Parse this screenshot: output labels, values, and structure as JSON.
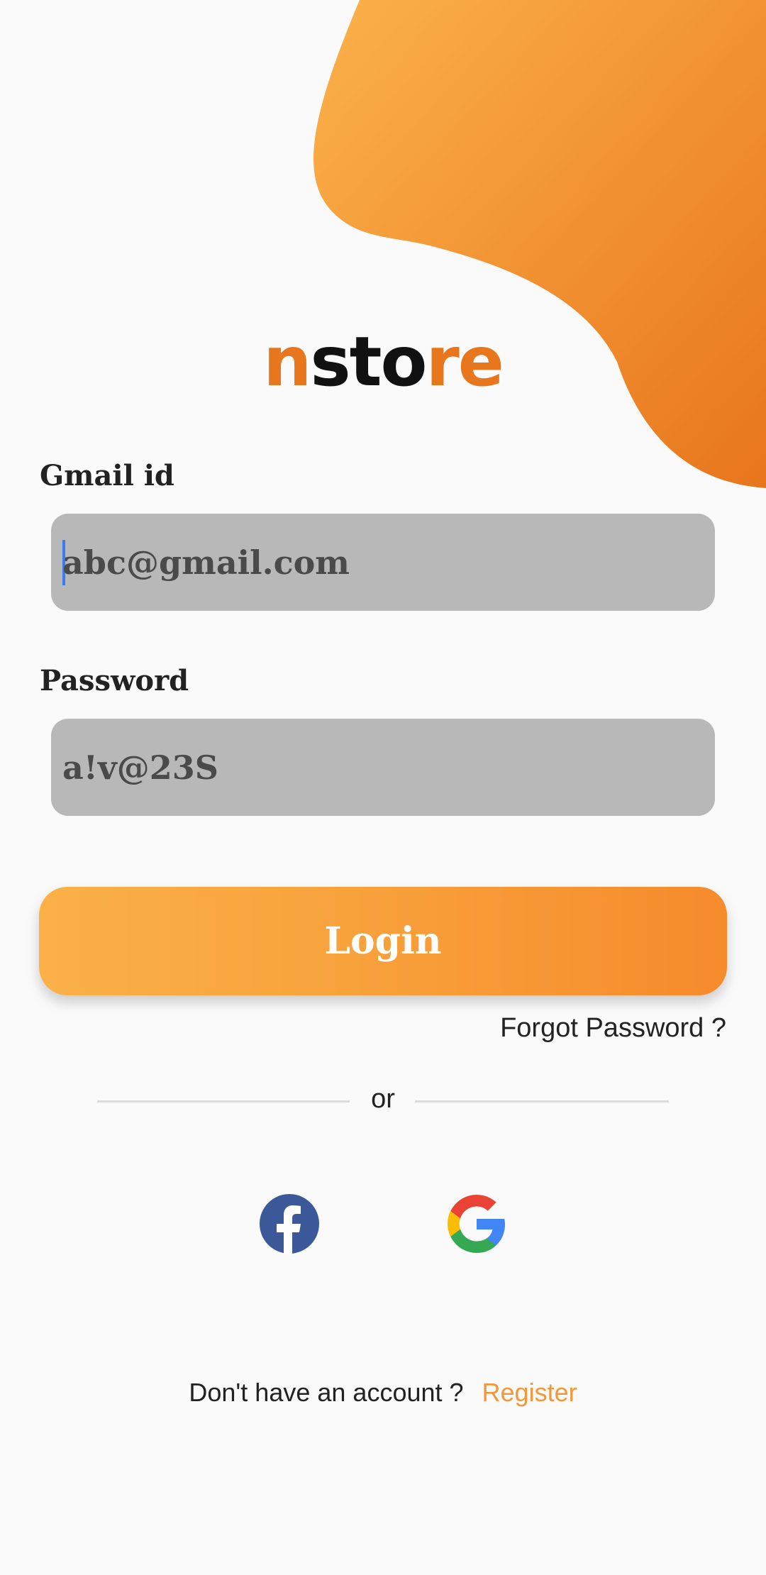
{
  "logo": {
    "part1": "n",
    "part2": "sto",
    "part3": "re"
  },
  "email": {
    "label": "Gmail id",
    "value": "abc@gmail.com"
  },
  "password": {
    "label": "Password",
    "value": "a!v@23S"
  },
  "login_label": "Login",
  "forgot_label": "Forgot Password ?",
  "divider_text": "or",
  "social": {
    "facebook_icon": "facebook-icon",
    "google_icon": "google-icon"
  },
  "footer": {
    "question": "Don't have an account ?",
    "register_label": "Register"
  },
  "colors": {
    "accent": "#f4963a",
    "brand_orange": "#e8761c",
    "input_bg": "#b8b8b8",
    "background": "#fafafa"
  }
}
